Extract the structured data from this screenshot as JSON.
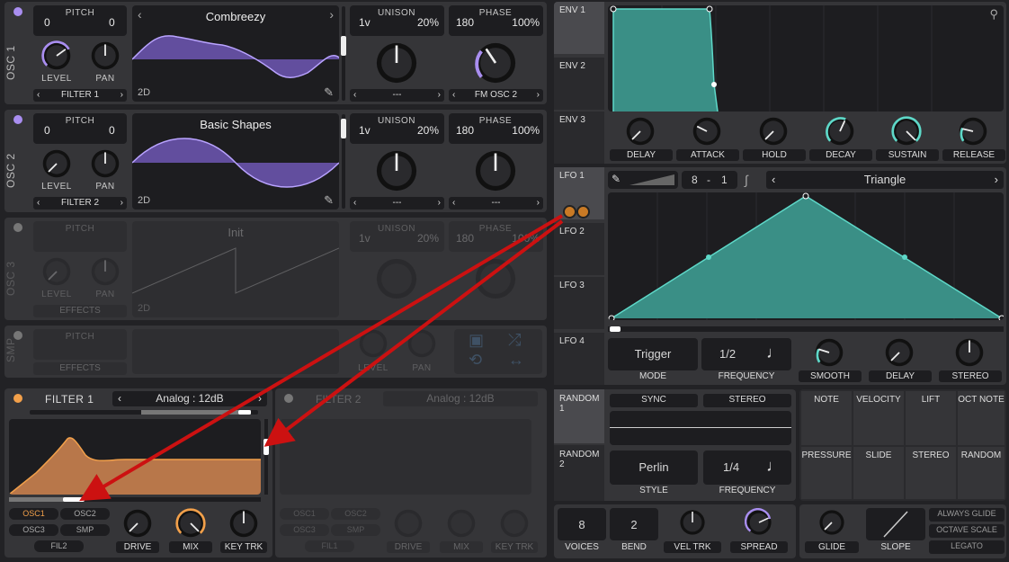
{
  "colors": {
    "osc_active": "#a98ef0",
    "teal": "#5ed8c8",
    "filter_orange": "#f2a04a",
    "arrow": "#cc1111"
  },
  "osc1": {
    "label": "OSC 1",
    "pitch_label": "PITCH",
    "pitch_left": "0",
    "pitch_right": "0",
    "level": "LEVEL",
    "pan": "PAN",
    "dest": "FILTER 1",
    "wavetable": "Combreezy",
    "mode": "2D",
    "unison_label": "UNISON",
    "voices": "1v",
    "detune": "20%",
    "phase_label": "PHASE",
    "phase": "180",
    "phase_rand": "100%",
    "unison_dest": "---",
    "phase_dest": "FM OSC 2"
  },
  "osc2": {
    "label": "OSC 2",
    "pitch_label": "PITCH",
    "pitch_left": "0",
    "pitch_right": "0",
    "level": "LEVEL",
    "pan": "PAN",
    "dest": "FILTER 2",
    "wavetable": "Basic Shapes",
    "mode": "2D",
    "unison_label": "UNISON",
    "voices": "1v",
    "detune": "20%",
    "phase_label": "PHASE",
    "phase": "180",
    "phase_rand": "100%",
    "unison_dest": "---",
    "phase_dest": "---"
  },
  "osc3": {
    "label": "OSC 3",
    "pitch_label": "PITCH",
    "level": "LEVEL",
    "pan": "PAN",
    "dest": "EFFECTS",
    "wavetable": "Init",
    "mode": "2D",
    "unison_label": "UNISON",
    "voices": "1v",
    "detune": "20%",
    "phase_label": "PHASE",
    "phase": "180",
    "phase_rand": "100%"
  },
  "smp": {
    "label": "SMP",
    "pitch_label": "PITCH",
    "dest": "EFFECTS",
    "level": "LEVEL",
    "pan": "PAN"
  },
  "filter1": {
    "label": "FILTER 1",
    "model": "Analog : 12dB",
    "btns": [
      "OSC1",
      "OSC2",
      "OSC3",
      "SMP",
      "FIL2"
    ],
    "drive": "DRIVE",
    "mix": "MIX",
    "key": "KEY TRK"
  },
  "filter2": {
    "label": "FILTER 2",
    "model": "Analog : 12dB",
    "btns": [
      "OSC1",
      "OSC2",
      "OSC3",
      "SMP",
      "FIL1"
    ],
    "drive": "DRIVE",
    "mix": "MIX",
    "key": "KEY TRK"
  },
  "env": {
    "tabs": [
      "ENV 1",
      "ENV 2",
      "ENV 3"
    ],
    "knobs": [
      "DELAY",
      "ATTACK",
      "HOLD",
      "DECAY",
      "SUSTAIN",
      "RELEASE"
    ]
  },
  "lfo": {
    "tabs": [
      "LFO 1",
      "LFO 2",
      "LFO 3",
      "LFO 4"
    ],
    "grid": "8",
    "grid_sep": "-",
    "grid2": "1",
    "shape": "Triangle",
    "mode_val": "Trigger",
    "mode": "MODE",
    "freq_val": "1/2",
    "freq": "FREQUENCY",
    "knobs": [
      "SMOOTH",
      "DELAY",
      "STEREO"
    ]
  },
  "random": {
    "tabs": [
      "RANDOM 1",
      "RANDOM 2"
    ],
    "sync": "SYNC",
    "stereo": "STEREO",
    "style_val": "Perlin",
    "style": "STYLE",
    "freq_val": "1/4",
    "freq": "FREQUENCY"
  },
  "mod": {
    "row1": [
      "NOTE",
      "VELOCITY",
      "LIFT",
      "OCT NOTE"
    ],
    "row2": [
      "PRESSURE",
      "SLIDE",
      "STEREO",
      "RANDOM"
    ]
  },
  "voice": {
    "voices_val": "8",
    "voices": "VOICES",
    "bend_val": "2",
    "bend": "BEND",
    "veltrk": "VEL TRK",
    "spread": "SPREAD",
    "glide": "GLIDE",
    "slope": "SLOPE",
    "always_glide": "ALWAYS GLIDE",
    "octave_scale": "OCTAVE SCALE",
    "legato": "LEGATO"
  }
}
